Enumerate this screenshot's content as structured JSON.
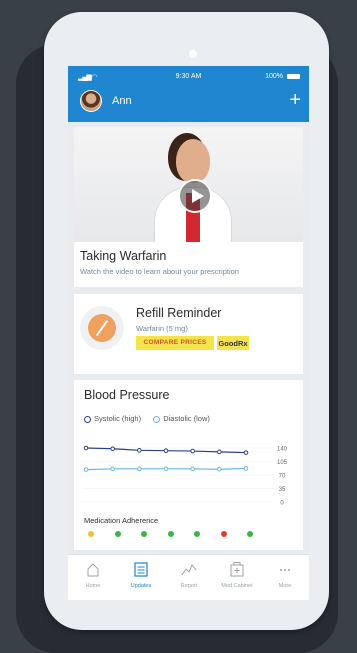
{
  "status_bar": {
    "time": "9:30 AM",
    "battery": "100%"
  },
  "header": {
    "username": "Ann"
  },
  "video_card": {
    "title": "Taking Warfarin",
    "subtitle": "Watch the video to learn about your prescription"
  },
  "refill_card": {
    "title": "Refill Reminder",
    "drug": "Warfarin (5 mg)",
    "compare_label": "COMPARE PRICES",
    "goodrx_label": "GoodRx"
  },
  "bp_card": {
    "title": "Blood Pressure",
    "legend_systolic": "Systolic (high)",
    "legend_diastolic": "Diastolic (low)",
    "adherence_label": "Medication Adherence",
    "adherence": [
      "#f3c12e",
      "#3cb54a",
      "#3cb54a",
      "#3cb54a",
      "#3cb54a",
      "#e8392d",
      "#3cb54a"
    ]
  },
  "chart_data": {
    "type": "line",
    "x": [
      1,
      2,
      3,
      4,
      5,
      6,
      7
    ],
    "series": [
      {
        "name": "Systolic (high)",
        "values": [
          140,
          138,
          134,
          133,
          132,
          130,
          128
        ],
        "color": "#2f3f8f"
      },
      {
        "name": "Diastolic (low)",
        "values": [
          84,
          86,
          86,
          86,
          86,
          85,
          87
        ],
        "color": "#69b8e0"
      }
    ],
    "yticks": [
      "140",
      "105",
      "70",
      "35",
      "0"
    ],
    "ylim": [
      0,
      140
    ]
  },
  "tabs": [
    {
      "label": "Home",
      "icon": "home-icon"
    },
    {
      "label": "Updates",
      "icon": "updates-icon"
    },
    {
      "label": "Report",
      "icon": "report-icon"
    },
    {
      "label": "Med Cabinet",
      "icon": "med-cabinet-icon"
    },
    {
      "label": "More",
      "icon": "more-icon"
    }
  ],
  "colors": {
    "accent": "#1f86cf",
    "background": "#3a4048"
  }
}
